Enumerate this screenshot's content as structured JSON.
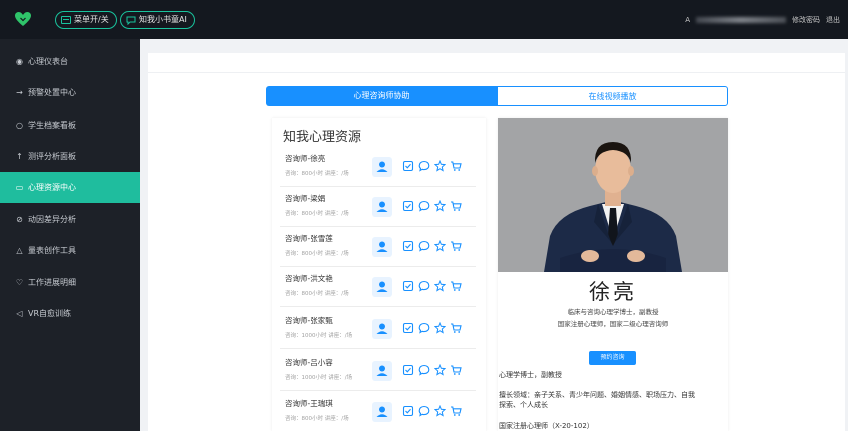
{
  "topbar": {
    "menu_toggle_label": "菜单开/关",
    "ai_label": "知我小书童AI",
    "user_initial": "A",
    "change_password": "修改密码",
    "logout": "退出"
  },
  "sidebar": {
    "items": [
      {
        "icon": "◉",
        "label": "心理仪表台",
        "active": false
      },
      {
        "icon": "→",
        "label": "预警处置中心",
        "active": false
      },
      {
        "icon": "○",
        "label": "学生档案看板",
        "active": false
      },
      {
        "icon": "↑",
        "label": "测评分析面板",
        "active": false
      },
      {
        "icon": "▭",
        "label": "心理资源中心",
        "active": true
      },
      {
        "icon": "⊘",
        "label": "动因差异分析",
        "active": false
      },
      {
        "icon": "△",
        "label": "量表创作工具",
        "active": false
      },
      {
        "icon": "♡",
        "label": "工作进展明细",
        "active": false
      },
      {
        "icon": "◁",
        "label": "VR自愈训练",
        "active": false
      }
    ]
  },
  "tabs": {
    "active": "心理咨询师协助",
    "inactive": "在线视频播放"
  },
  "resources": {
    "title": "知我心理资源",
    "counselors": [
      {
        "name": "咨询师-徐亮",
        "meta": "咨询：800小时 讲座：/场"
      },
      {
        "name": "咨询师-梁娟",
        "meta": "咨询：800小时 讲座：/场"
      },
      {
        "name": "咨询师-张雪莲",
        "meta": "咨询：800小时 讲座：/场"
      },
      {
        "name": "咨询师-洪文艳",
        "meta": "咨询：800小时 讲座：/场"
      },
      {
        "name": "咨询师-张家甄",
        "meta": "咨询：1000小时 讲座：/场"
      },
      {
        "name": "咨询师-吕小容",
        "meta": "咨询：1000小时 讲座：/场"
      },
      {
        "name": "咨询师-王瑞琪",
        "meta": "咨询：800小时 讲座：/场"
      }
    ]
  },
  "detail": {
    "name": "徐亮",
    "line1": "临床与咨询心理学博士，副教授",
    "line2": "国家注册心理师，国家二级心理咨询师",
    "book_button": "预约咨询",
    "info1": "心理学博士，副教授",
    "info2a": "擅长领域：亲子关系、青少年问题、婚姻情感、职场压力、自我",
    "info2b": "探索、个人成长",
    "info3": "国家注册心理师（X-20-102）"
  },
  "colors": {
    "accent": "#1fbd9e",
    "primary_blue": "#1890ff",
    "topbar": "#14181f",
    "sidebar": "#1d2128"
  }
}
